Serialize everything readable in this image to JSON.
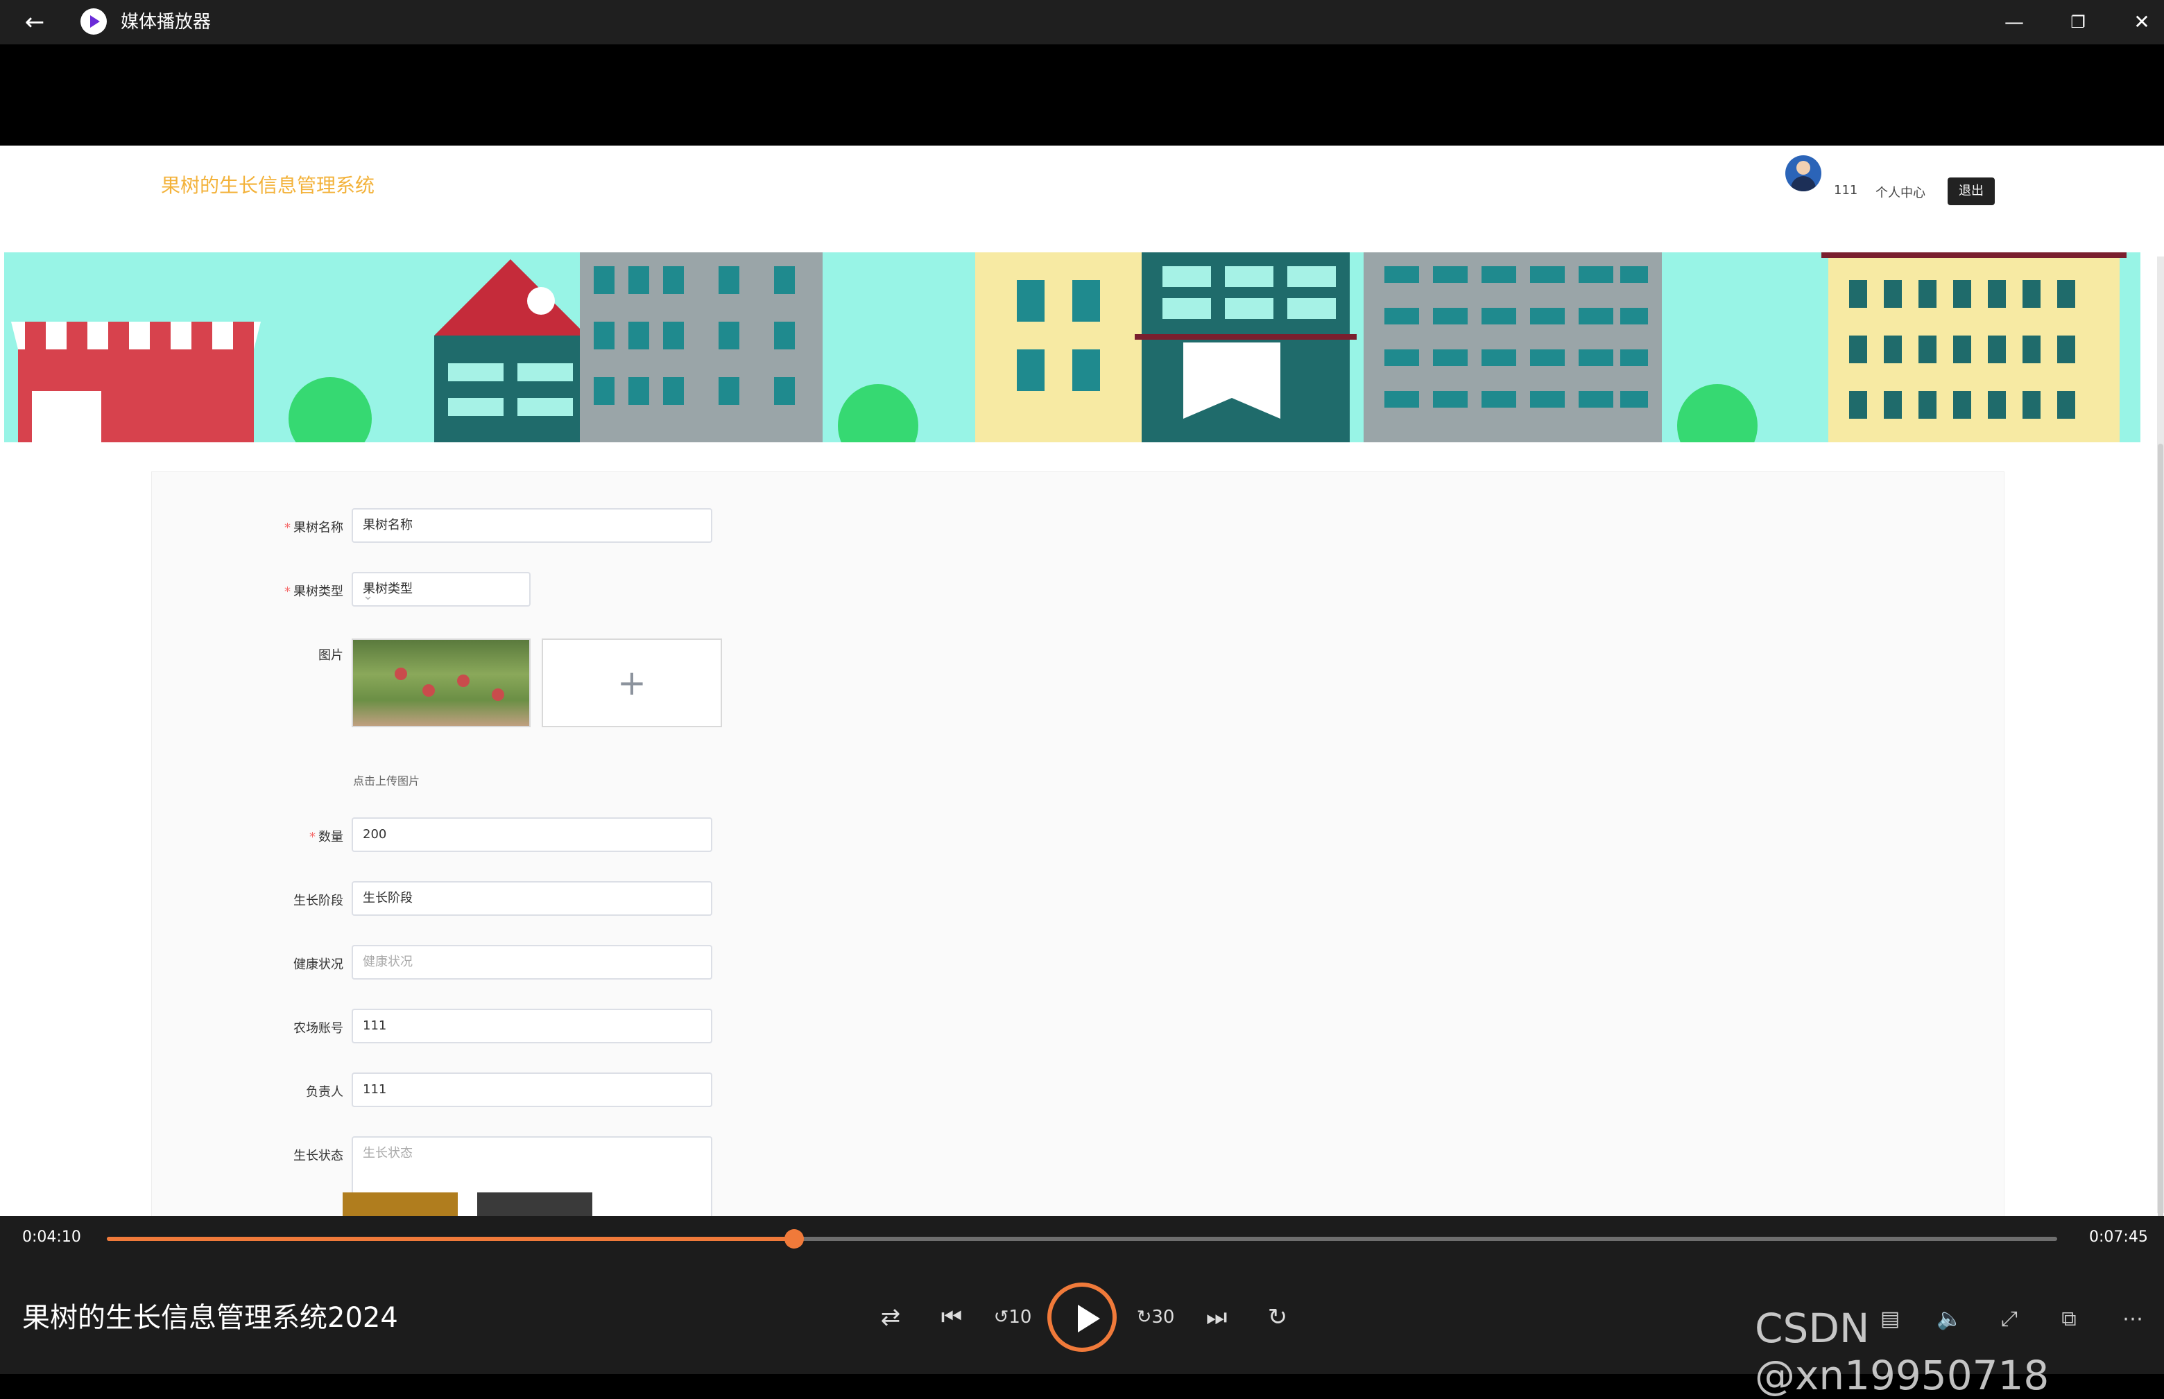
{
  "window": {
    "title": "媒体播放器",
    "back_icon": "back-arrow-icon",
    "controls": [
      "minimize-icon",
      "maximize-icon",
      "close-icon"
    ]
  },
  "app": {
    "title": "果树的生长信息管理系统",
    "user": {
      "name": "111",
      "center_label": "个人中心",
      "logout_label": "退出"
    },
    "form": {
      "fruit_name": {
        "label": "果树名称",
        "value": "果树名称"
      },
      "fruit_type": {
        "label": "果树类型",
        "value": "果树类型"
      },
      "image": {
        "label": "图片",
        "hint": "点击上传图片"
      },
      "quantity": {
        "label": "数量",
        "value": "200"
      },
      "growth_stage": {
        "label": "生长阶段",
        "value": "生长阶段"
      },
      "health_status": {
        "label": "健康状况",
        "placeholder": "健康状况"
      },
      "farm_account": {
        "label": "农场账号",
        "value": "111"
      },
      "owner": {
        "label": "负责人",
        "value": "111"
      },
      "growth_state": {
        "label": "生长状态",
        "placeholder": "生长状态"
      }
    }
  },
  "player": {
    "current_time": "0:04:10",
    "total_time": "0:07:45",
    "progress": 0.3523,
    "media_title": "果树的生长信息管理系统2024",
    "watermark": "CSDN @xn19950718",
    "accent_color": "#f07a3a"
  }
}
